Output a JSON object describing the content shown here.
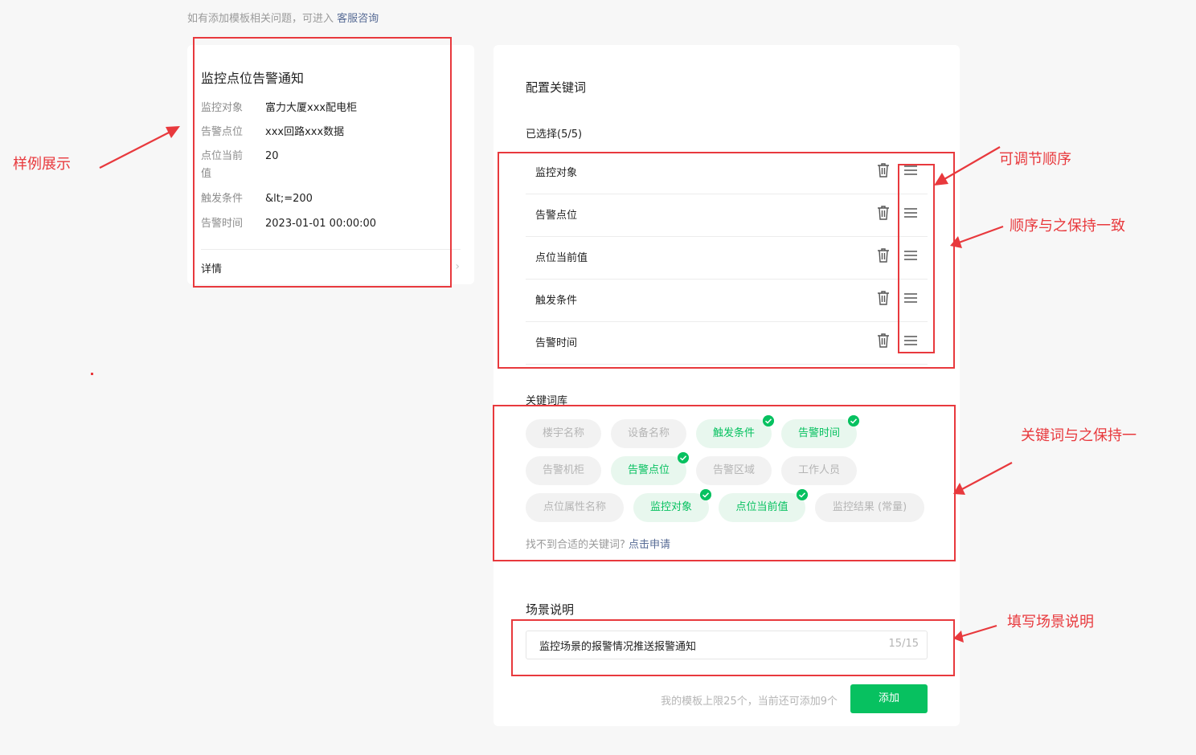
{
  "top_hint": {
    "text": "如有添加模板相关问题，可进入",
    "link": "客服咨询"
  },
  "preview": {
    "title": "监控点位告警通知",
    "rows": [
      {
        "label": "监控对象",
        "value": "富力大厦xxx配电柜"
      },
      {
        "label": "告警点位",
        "value": "xxx回路xxx数据"
      },
      {
        "label": "点位当前值",
        "value": "20"
      },
      {
        "label": "触发条件",
        "value": "&lt;=200"
      },
      {
        "label": "告警时间",
        "value": "2023-01-01 00:00:00"
      }
    ],
    "detail_label": "详情",
    "chevron": "›"
  },
  "config": {
    "title": "配置关键词",
    "selected_label": "已选择(5/5)",
    "selected": [
      "监控对象",
      "告警点位",
      "点位当前值",
      "触发条件",
      "告警时间"
    ],
    "library_title": "关键词库",
    "library": [
      {
        "label": "楼宇名称",
        "selected": false
      },
      {
        "label": "设备名称",
        "selected": false
      },
      {
        "label": "触发条件",
        "selected": true
      },
      {
        "label": "告警时间",
        "selected": true
      },
      {
        "label": "告警机柜",
        "selected": false
      },
      {
        "label": "告警点位",
        "selected": true
      },
      {
        "label": "告警区域",
        "selected": false
      },
      {
        "label": "工作人员",
        "selected": false
      },
      {
        "label": "点位属性名称",
        "selected": false
      },
      {
        "label": "监控对象",
        "selected": true
      },
      {
        "label": "点位当前值",
        "selected": true
      },
      {
        "label": "监控结果 (常量)",
        "selected": false
      }
    ],
    "library_hint": "找不到合适的关键词?",
    "library_hint_link": "点击申请",
    "scene_title": "场景说明",
    "scene_value": "监控场景的报警情况推送报警通知",
    "scene_count": "15/15",
    "limit_hint": "我的模板上限25个，当前还可添加9个",
    "add_button": "添加"
  },
  "icons": {
    "delete": "trash-icon",
    "drag": "drag-handle-icon",
    "check": "check-icon"
  },
  "colors": {
    "accent": "#07c160",
    "annotation": "#e8393d",
    "link": "#576b95"
  },
  "annotations": {
    "sample": "样例展示",
    "reorder": "可调节顺序",
    "order_consistent": "顺序与之保持一致",
    "keyword_consistent": "关键词与之保持一",
    "fill_scene": "填写场景说明"
  }
}
